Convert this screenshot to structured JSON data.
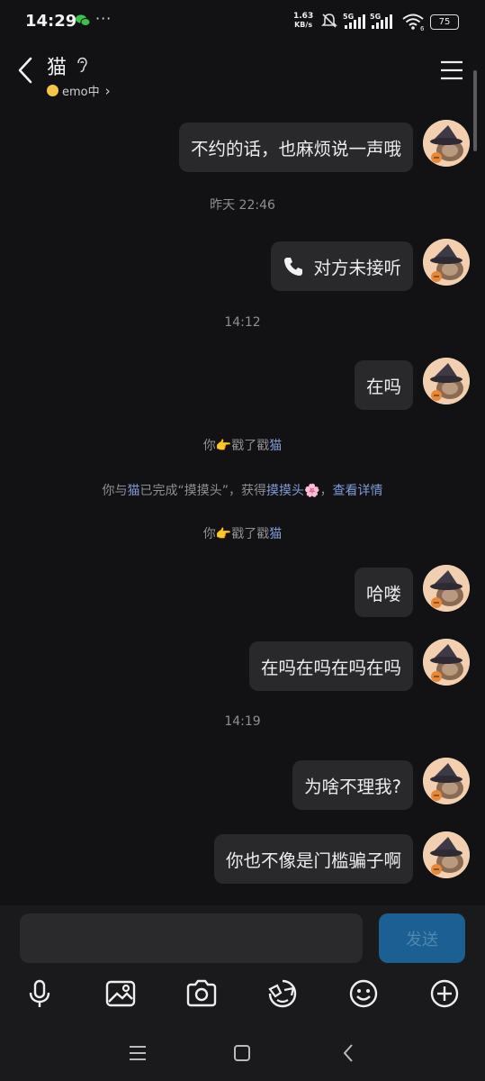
{
  "status_bar": {
    "time": "14:29",
    "net_speed_value": "1.63",
    "net_speed_unit": "KB/s",
    "battery": "75",
    "signal_1": "5G",
    "signal_2": "5G",
    "wifi_sub": "6"
  },
  "header": {
    "title": "猫",
    "status": "emo中",
    "status_chevron": "›"
  },
  "messages": [
    {
      "type": "bubble",
      "text": "不约的话，也麻烦说一声哦"
    },
    {
      "type": "timestamp",
      "text": "昨天 22:46"
    },
    {
      "type": "call",
      "icon": "phone-icon",
      "text": "对方未接听"
    },
    {
      "type": "timestamp",
      "text": "14:12"
    },
    {
      "type": "bubble",
      "text": "在吗"
    },
    {
      "type": "system",
      "text": "你👉戳了戳猫"
    },
    {
      "type": "system",
      "text": "你与猫已完成“摸摸头”，获得摸摸头🌸，查看详情"
    },
    {
      "type": "system",
      "text": "你👉戳了戳猫"
    },
    {
      "type": "bubble",
      "text": "哈喽"
    },
    {
      "type": "bubble",
      "text": "在吗在吗在吗在吗"
    },
    {
      "type": "timestamp",
      "text": "14:19"
    },
    {
      "type": "bubble",
      "text": "为啥不理我?"
    },
    {
      "type": "bubble",
      "text": "你也不像是门槛骗子啊"
    }
  ],
  "poke1": {
    "you": "你",
    "action": "戳了戳",
    "name": "猫",
    "emoji": "👉"
  },
  "touch": {
    "prefix": "你与",
    "name": "猫",
    "middle": "已完成“摸摸头”，获得",
    "reward": "摸摸头",
    "emoji": "🌸",
    "comma": "，",
    "details": "查看详情"
  },
  "poke2": {
    "you": "你",
    "action": "戳了戳",
    "name": "猫",
    "emoji": "👉"
  },
  "composer": {
    "send_label": "发送",
    "tools": [
      "mic-icon",
      "image-icon",
      "camera-icon",
      "sticker-icon",
      "emoji-icon",
      "plus-icon"
    ]
  },
  "colors": {
    "background": "#121214",
    "bubble": "#29292c",
    "send_button": "#1b5f93",
    "link": "#7f9ad6",
    "avatar_bg": "#f2cfb1"
  }
}
